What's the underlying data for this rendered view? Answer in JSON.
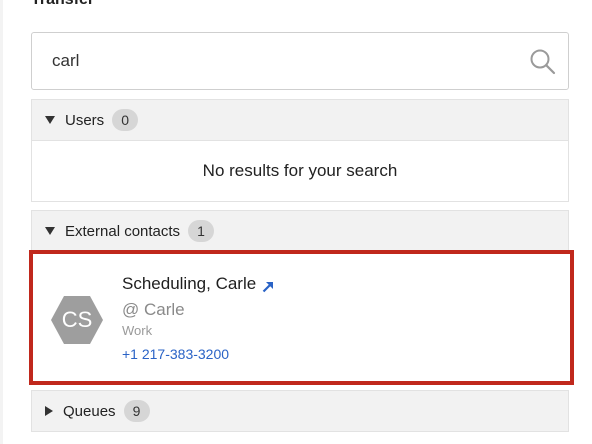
{
  "panel": {
    "title": "Transfer"
  },
  "search": {
    "value": "carl",
    "icon": "search-icon"
  },
  "sections": {
    "users": {
      "label": "Users",
      "count": "0",
      "expanded": true,
      "empty_message": "No results for your search"
    },
    "external_contacts": {
      "label": "External contacts",
      "count": "1",
      "expanded": true,
      "contacts": [
        {
          "initials": "CS",
          "name": "Scheduling, Carle",
          "handle": "@ Carle",
          "type": "Work",
          "phone": "+1 217-383-3200",
          "link_icon": "external-link-icon"
        }
      ]
    },
    "queues": {
      "label": "Queues",
      "count": "9",
      "expanded": false
    }
  },
  "colors": {
    "highlight_border": "#c0281c",
    "link": "#2a63c6",
    "avatar_bg": "#9e9e9e",
    "badge_bg": "#d6d6d6",
    "section_bg": "#f2f2f2"
  }
}
